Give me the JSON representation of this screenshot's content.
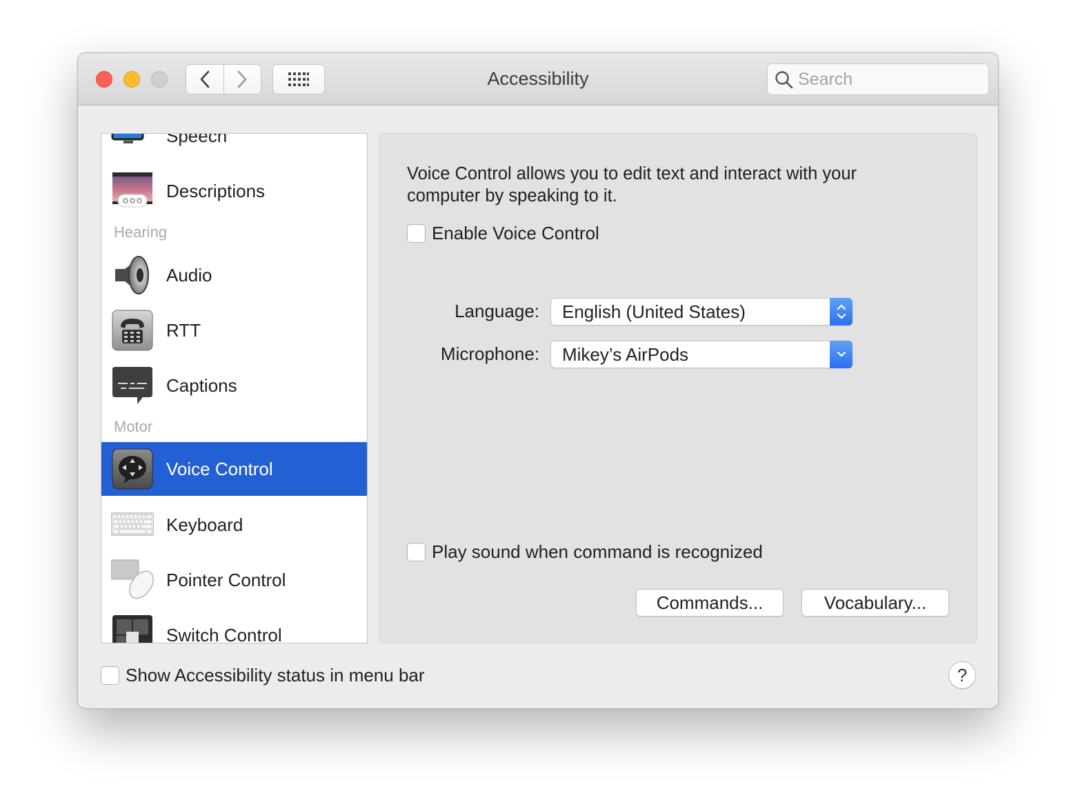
{
  "window": {
    "title": "Accessibility",
    "search_placeholder": "Search"
  },
  "sidebar": {
    "items": [
      {
        "label": "Speech",
        "icon": "speech-icon"
      },
      {
        "label": "Descriptions",
        "icon": "descriptions-icon"
      },
      {
        "section": "Hearing"
      },
      {
        "label": "Audio",
        "icon": "speaker-icon"
      },
      {
        "label": "RTT",
        "icon": "tty-phone-icon"
      },
      {
        "label": "Captions",
        "icon": "captions-icon"
      },
      {
        "section": "Motor"
      },
      {
        "label": "Voice Control",
        "icon": "voice-control-icon",
        "selected": true
      },
      {
        "label": "Keyboard",
        "icon": "keyboard-icon"
      },
      {
        "label": "Pointer Control",
        "icon": "pointer-control-icon"
      },
      {
        "label": "Switch Control",
        "icon": "switch-control-icon"
      }
    ]
  },
  "voice_control": {
    "description": "Voice Control allows you to edit text and interact with your computer by speaking to it.",
    "enable_label": "Enable Voice Control",
    "enable_checked": false,
    "language_label": "Language:",
    "language_value": "English (United States)",
    "microphone_label": "Microphone:",
    "microphone_value": "Mikey’s AirPods",
    "play_sound_label": "Play sound when command is recognized",
    "play_sound_checked": false,
    "commands_button": "Commands...",
    "vocabulary_button": "Vocabulary..."
  },
  "footer": {
    "show_status_label": "Show Accessibility status in menu bar",
    "show_status_checked": false,
    "help_label": "?"
  },
  "colors": {
    "selection": "#2360d4",
    "close": "#fc5f57",
    "minimize": "#fdbc2e",
    "popup_accent": "#2b6ff0"
  }
}
